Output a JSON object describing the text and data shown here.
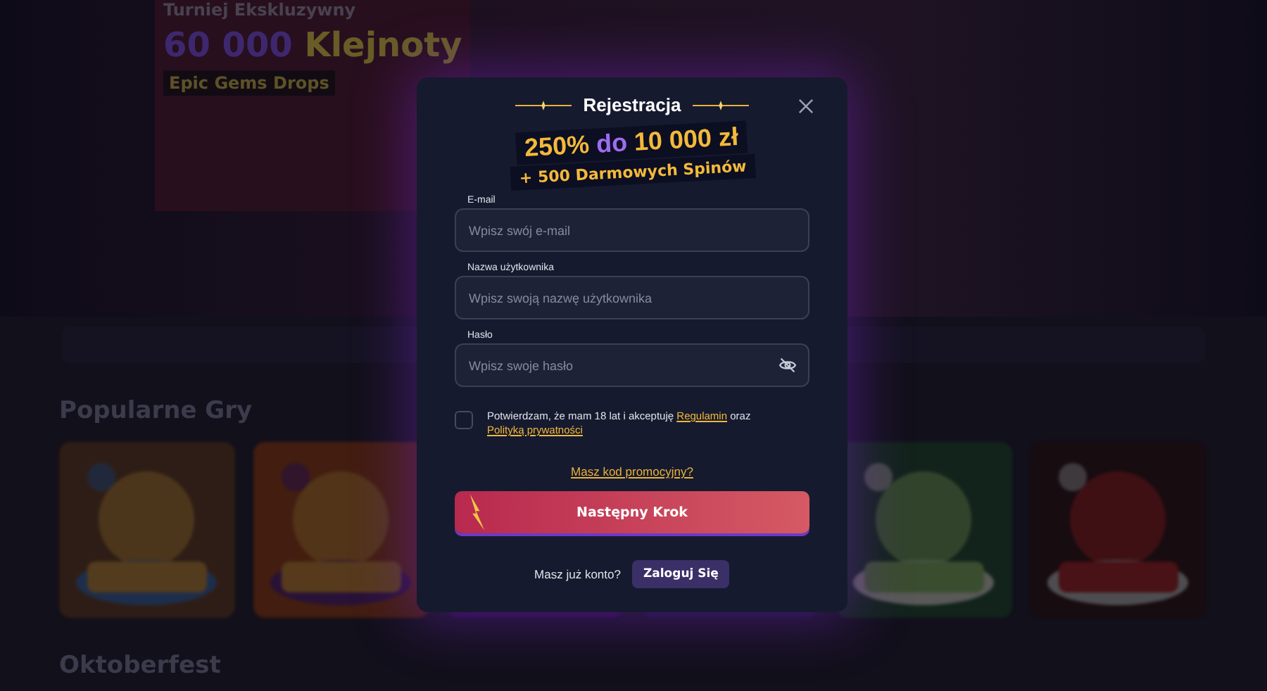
{
  "background": {
    "banner": {
      "kicker": "Turniej Ekskluzywny",
      "headline_number": "60 000",
      "headline_word": "Klejnoty",
      "subtitle": "Epic Gems Drops"
    },
    "sections": [
      {
        "title": "Popularne Gry"
      },
      {
        "title": "Oktoberfest"
      }
    ]
  },
  "modal": {
    "title": "Rejestracja",
    "promo_line1": "250% **do** 10 000 zł",
    "promo_line2": "+ 500 Darmowych Spinów",
    "fields": [
      {
        "label": "E-mail",
        "placeholder": "Wpisz swój e-mail",
        "kind": "text"
      },
      {
        "label": "Nazwa użytkownika",
        "placeholder": "Wpisz swoją nazwę użytkownika",
        "kind": "text"
      },
      {
        "label": "Hasło",
        "placeholder": "Wpisz swoje hasło",
        "kind": "password"
      }
    ],
    "consent": {
      "checked": false,
      "text": "Potwierdzam, że mam 18 lat i akceptuję",
      "link1": "Regulamin",
      "joiner": "oraz",
      "link2": "Polityką prywatności"
    },
    "promo_link": "Masz kod promocyjny?",
    "submit": "Następny Krok",
    "login_prompt": "Masz już konto?",
    "login_button": "Zaloguj Się"
  }
}
